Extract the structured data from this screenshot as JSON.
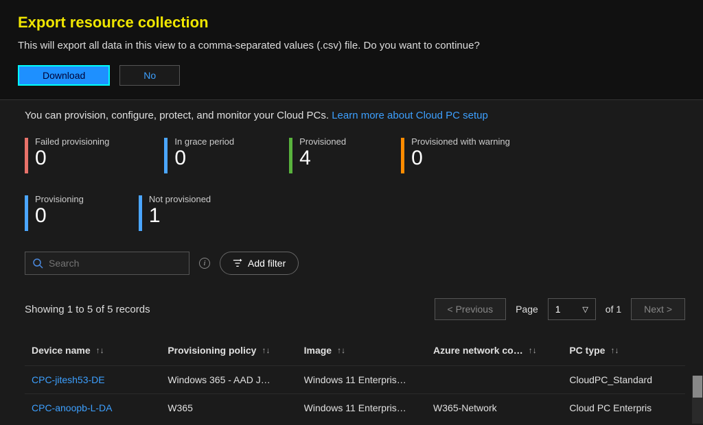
{
  "dialog": {
    "title": "Export resource collection",
    "text": "This will export all data in this view to a comma-separated values (.csv) file. Do you want to continue?",
    "download_label": "Download",
    "no_label": "No"
  },
  "info": {
    "prefix": "You can provision, configure, protect, and monitor your Cloud PCs. ",
    "link_text": "Learn more about Cloud PC setup"
  },
  "stats": {
    "failed_provisioning": {
      "label": "Failed provisioning",
      "count": "0"
    },
    "in_grace_period": {
      "label": "In grace period",
      "count": "0"
    },
    "provisioned": {
      "label": "Provisioned",
      "count": "4"
    },
    "provisioned_warning": {
      "label": "Provisioned with warning",
      "count": "0"
    },
    "provisioning": {
      "label": "Provisioning",
      "count": "0"
    },
    "not_provisioned": {
      "label": "Not provisioned",
      "count": "1"
    }
  },
  "filter": {
    "search_placeholder": "Search",
    "add_filter_label": "Add filter"
  },
  "pager": {
    "records_text": "Showing 1 to 5 of 5 records",
    "prev_label": "< Previous",
    "page_label": "Page",
    "page_value": "1",
    "of_text": "of 1",
    "next_label": "Next >"
  },
  "table": {
    "headers": {
      "device": "Device name",
      "policy": "Provisioning policy",
      "image": "Image",
      "network": "Azure network co…",
      "pctype": "PC type"
    },
    "rows": [
      {
        "device": "CPC-jitesh53-DE",
        "policy": "Windows 365 - AAD J…",
        "image": "Windows 11 Enterpris…",
        "network": "",
        "pctype": "CloudPC_Standard"
      },
      {
        "device": "CPC-anoopb-L-DA",
        "policy": "W365",
        "image": "Windows 11 Enterpris…",
        "network": "W365-Network",
        "pctype": "Cloud PC Enterpris"
      }
    ]
  }
}
